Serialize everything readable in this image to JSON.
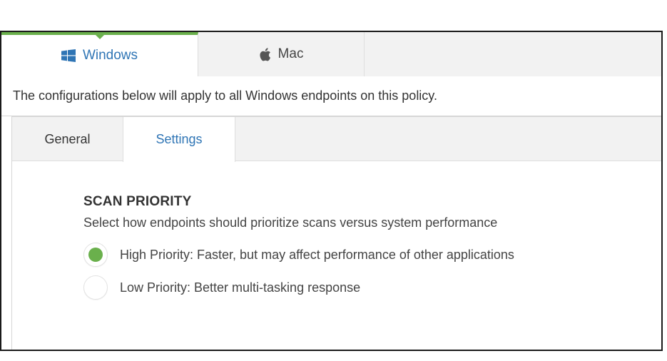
{
  "os_tabs": [
    {
      "label": "Windows",
      "icon": "windows-logo-icon",
      "active": true
    },
    {
      "label": "Mac",
      "icon": "apple-logo-icon",
      "active": false
    }
  ],
  "description": "The configurations below will apply to all Windows endpoints on this policy.",
  "sub_tabs": [
    {
      "label": "General",
      "active": false
    },
    {
      "label": "Settings",
      "active": true
    }
  ],
  "scan_priority": {
    "title": "SCAN PRIORITY",
    "subtitle": "Select how endpoints should prioritize scans versus system performance",
    "options": [
      {
        "label": "High Priority: Faster, but may affect performance of other applications",
        "selected": true
      },
      {
        "label": "Low Priority: Better multi-tasking response",
        "selected": false
      }
    ]
  },
  "colors": {
    "accent_green": "#6ab04c",
    "link_blue": "#2f75b5"
  }
}
